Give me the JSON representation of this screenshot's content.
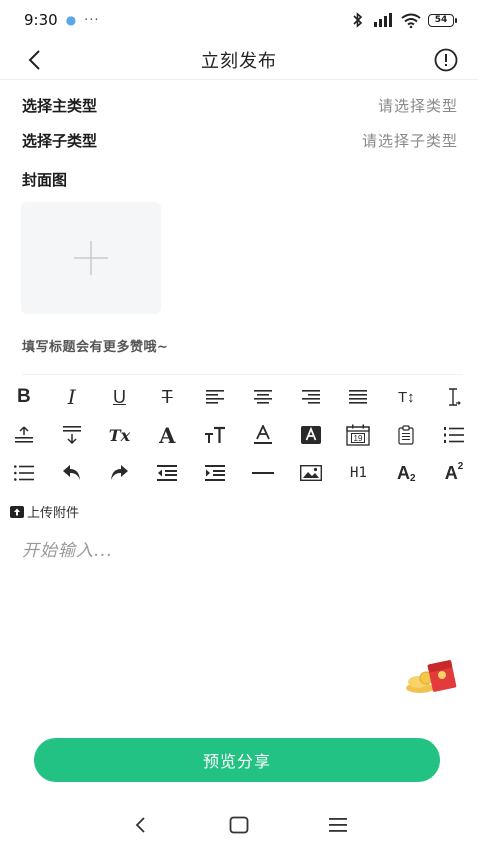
{
  "status_bar": {
    "time": "9:30",
    "dot": "●",
    "more": "···",
    "battery": "54"
  },
  "nav": {
    "title": "立刻发布"
  },
  "form": {
    "main_type_label": "选择主类型",
    "main_type_value": "请选择类型",
    "sub_type_label": "选择子类型",
    "sub_type_value": "请选择子类型",
    "cover_label": "封面图"
  },
  "hint": "填写标题会有更多赞哦~",
  "toolbar": {
    "bold": "B",
    "italic": "I",
    "underline": "U",
    "strike": "T",
    "text_size": "T↕",
    "font": "A",
    "heading": "H1",
    "subscript_base": "A",
    "subscript_mark": "2",
    "superscript_base": "A",
    "superscript_mark": "2",
    "clear_format": "Tx",
    "calendar_day": "19"
  },
  "attachment": {
    "label": "上传附件"
  },
  "editor": {
    "placeholder": "开始输入..."
  },
  "share_button": {
    "label": "预览分享"
  },
  "colors": {
    "accent": "#22c283",
    "placeholder": "#999999"
  }
}
